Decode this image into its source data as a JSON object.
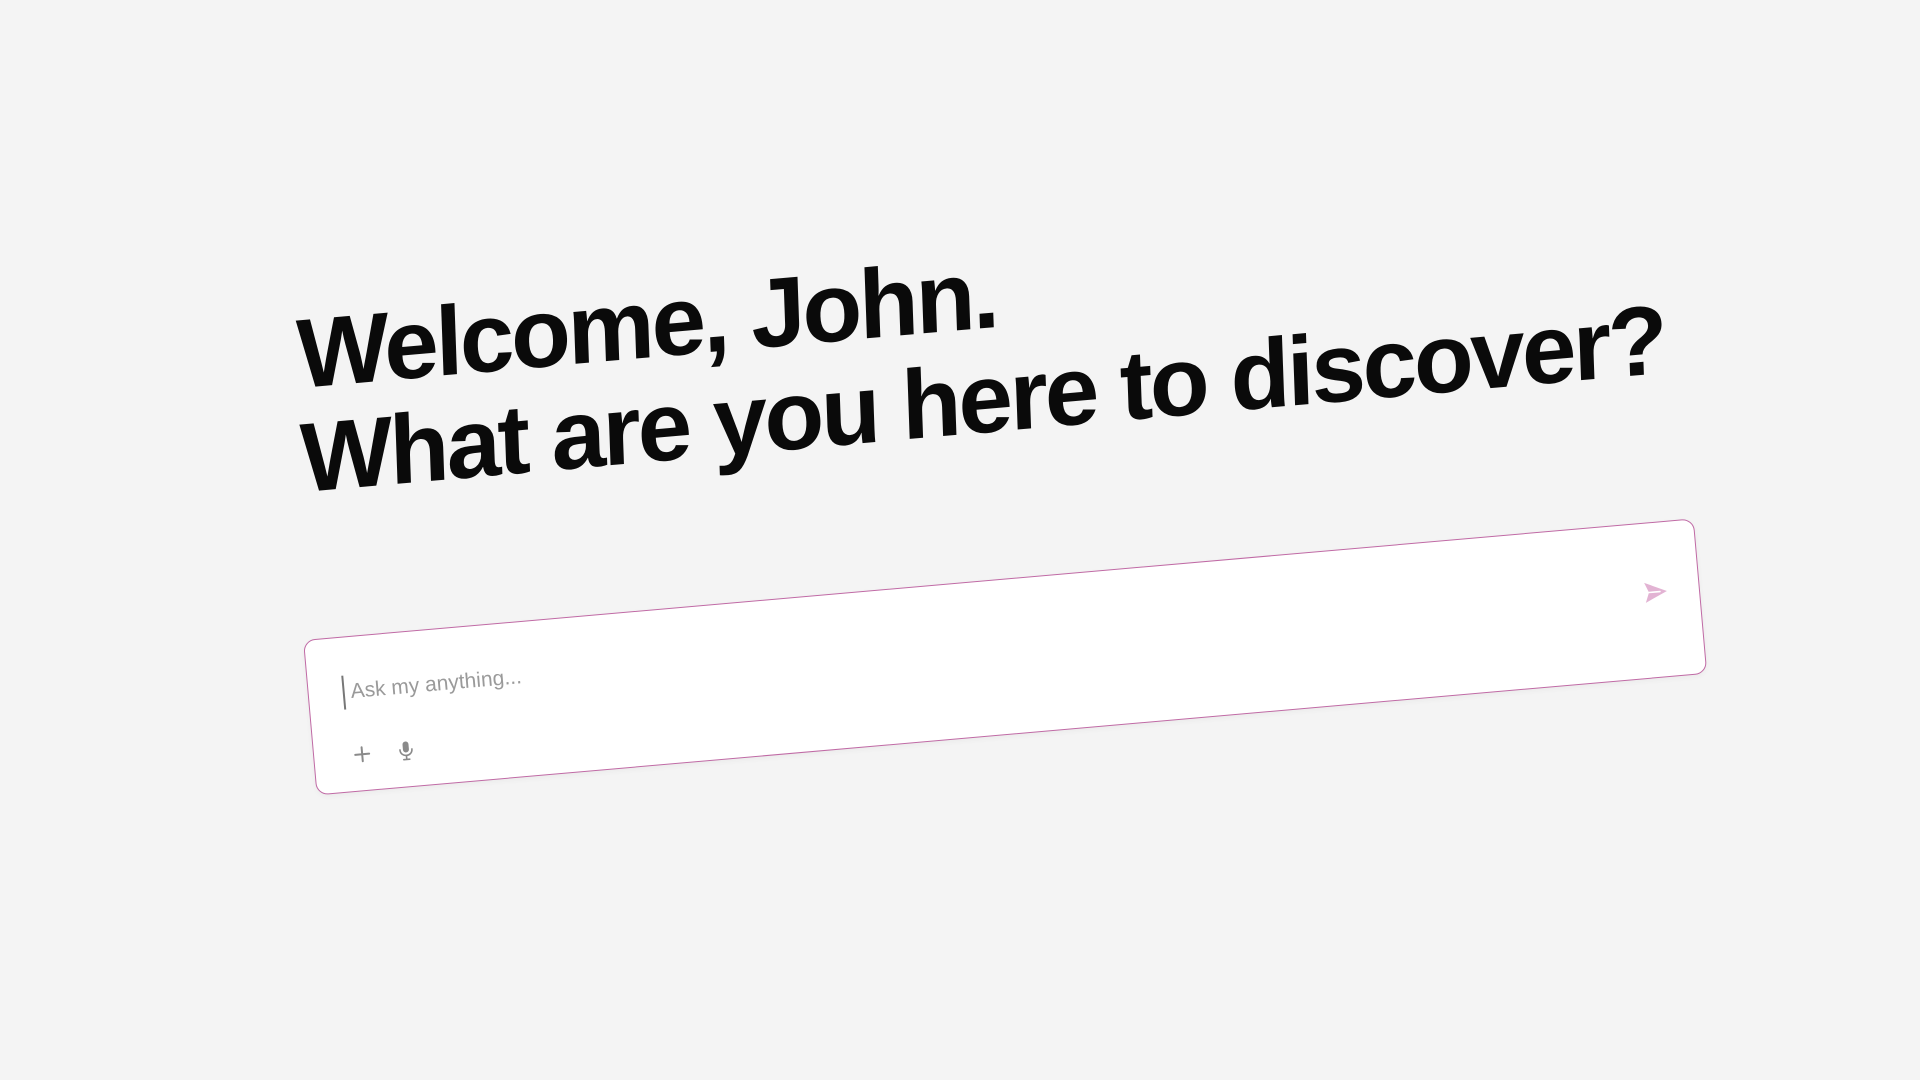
{
  "hero": {
    "line1": "Welcome, John.",
    "line2": "What are you here to discover?"
  },
  "composer": {
    "placeholder": "Ask my anything...",
    "value": ""
  },
  "icons": {
    "add": "plus-icon",
    "voice": "microphone-icon",
    "send": "send-icon"
  },
  "colors": {
    "background": "#f4f4f4",
    "text": "#0a0a0a",
    "accent": "#c06aa5",
    "send_icon": "#e2b3d3",
    "muted_icon": "#8a8a8a"
  }
}
